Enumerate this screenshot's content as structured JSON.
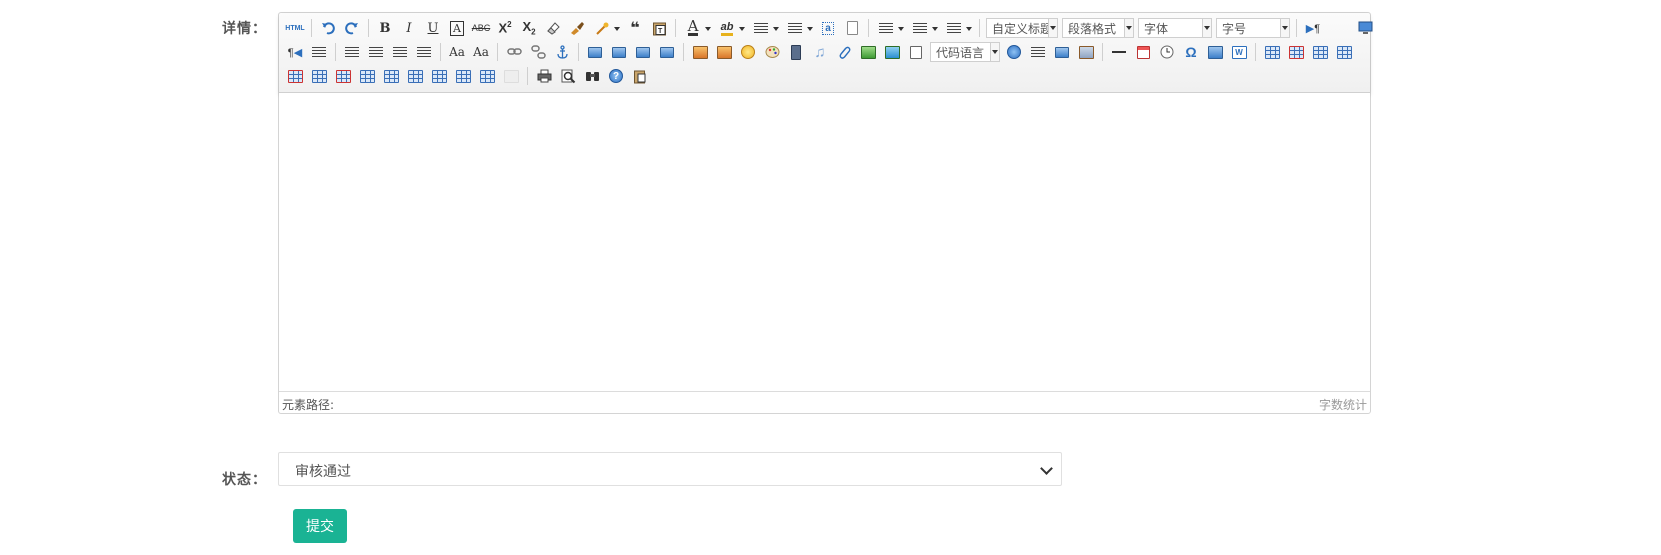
{
  "form": {
    "details_label": "详情：",
    "status_label": "状态：",
    "status_value": "审核通过",
    "submit_label": "提交"
  },
  "editor": {
    "toolbar": {
      "html_label": "HTML",
      "quote_glyph": "❝",
      "combo_custom_heading": "自定义标题",
      "combo_paragraph": "段落格式",
      "combo_font": "字体",
      "combo_font_size": "字号",
      "combo_code_language": "代码语言",
      "omega_glyph": "Ω"
    },
    "element_path_label": "元素路径:",
    "word_count_label": "字数统计"
  },
  "colors": {
    "accent": "#1ab394",
    "border": "#d4d4d4",
    "toolbar_bg": "#f0f0f0"
  }
}
